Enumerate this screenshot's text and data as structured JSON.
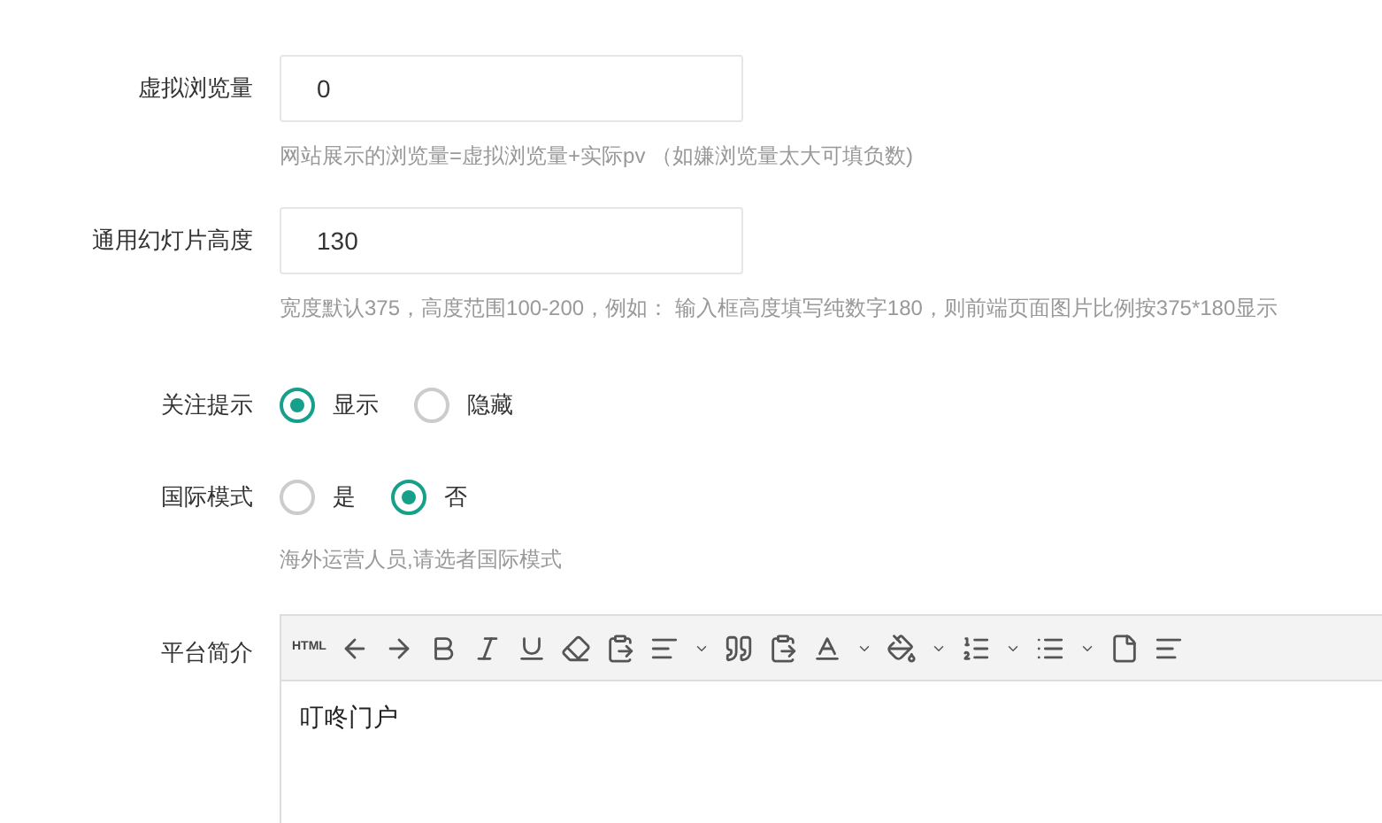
{
  "fields": [
    {
      "label": "虚拟浏览量",
      "value": "0",
      "hint": "网站展示的浏览量=虚拟浏览量+实际pv （如嫌浏览量太大可填负数)"
    },
    {
      "label": "通用幻灯片高度",
      "value": "130",
      "hint": "宽度默认375，高度范围100-200，例如： 输入框高度填写纯数字180，则前端页面图片比例按375*180显示"
    }
  ],
  "radio_groups": [
    {
      "label": "关注提示",
      "options": [
        {
          "label": "显示",
          "selected": true
        },
        {
          "label": "隐藏",
          "selected": false
        }
      ]
    },
    {
      "label": "国际模式",
      "options": [
        {
          "label": "是",
          "selected": false
        },
        {
          "label": "否",
          "selected": true
        }
      ],
      "hint": "海外运营人员,请选者国际模式"
    }
  ],
  "editor": {
    "label": "平台简介",
    "toolbar_html": "HTML",
    "content": "叮咚门户"
  }
}
